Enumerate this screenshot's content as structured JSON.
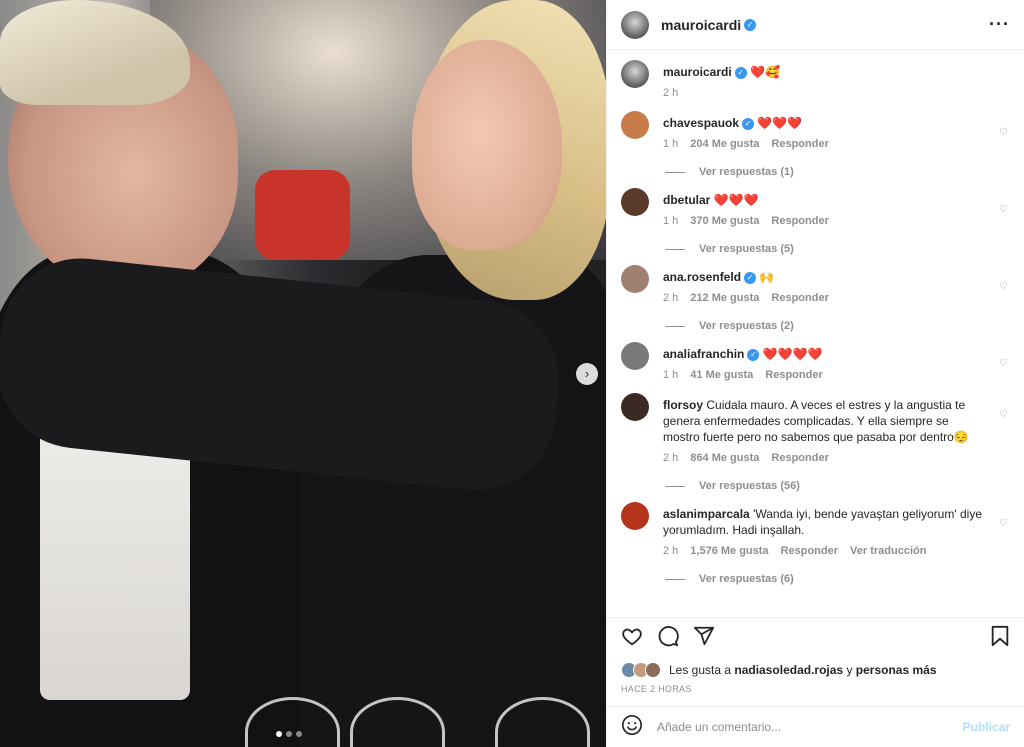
{
  "post": {
    "author": "mauroicardi",
    "more_icon": "more-icon"
  },
  "caption": {
    "user": "mauroicardi",
    "text": "❤️🥰",
    "time": "2 h"
  },
  "comments": [
    {
      "user": "chavespauok",
      "text": "❤️❤️❤️",
      "verified": true,
      "time": "1 h",
      "likes": "204 Me gusta",
      "reply": "Responder",
      "translate": "",
      "replies": "Ver respuestas (1)",
      "avatar_color": "#c97b4a"
    },
    {
      "user": "dbetular",
      "text": "❤️❤️❤️",
      "verified": false,
      "time": "1 h",
      "likes": "370 Me gusta",
      "reply": "Responder",
      "translate": "",
      "replies": "Ver respuestas (5)",
      "avatar_color": "#5a3a28"
    },
    {
      "user": "ana.rosenfeld",
      "text": "🙌",
      "verified": true,
      "time": "2 h",
      "likes": "212 Me gusta",
      "reply": "Responder",
      "translate": "",
      "replies": "Ver respuestas (2)",
      "avatar_color": "#a08070"
    },
    {
      "user": "analiafranchin",
      "text": "❤️❤️❤️❤️",
      "verified": true,
      "time": "1 h",
      "likes": "41 Me gusta",
      "reply": "Responder",
      "translate": "",
      "replies": "",
      "avatar_color": "#7a7a7a"
    },
    {
      "user": "florsoy",
      "text": "Cuidala mauro. A veces el estres y la angustia te genera enfermedades complicadas. Y ella siempre se mostro fuerte pero no sabemos que pasaba por dentro😔",
      "verified": false,
      "time": "2 h",
      "likes": "864 Me gusta",
      "reply": "Responder",
      "translate": "",
      "replies": "Ver respuestas (56)",
      "avatar_color": "#3b2a24"
    },
    {
      "user": "aslanimparcala",
      "text": "'Wanda iyi, bende yavaştan geliyorum' diye yorumladım. Hadi inşallah.",
      "verified": false,
      "time": "2 h",
      "likes": "1,576 Me gusta",
      "reply": "Responder",
      "translate": "Ver traducción",
      "replies": "Ver respuestas (6)",
      "avatar_color": "#b5341c"
    }
  ],
  "actions": {
    "like_icon": "heart-icon",
    "comment_icon": "comment-icon",
    "share_icon": "share-icon",
    "save_icon": "bookmark-icon"
  },
  "likes": {
    "prefix": "Les gusta a",
    "user": "nadiasoledad.rojas",
    "middle": "y",
    "rest": "personas más"
  },
  "timestamp": "HACE 2 HORAS",
  "add_comment": {
    "placeholder": "Añade un comentario...",
    "publish": "Publicar"
  },
  "colors": {
    "verified": "#3897f0",
    "publish_disabled": "#b2dffc",
    "muted": "#8e8e8e"
  }
}
